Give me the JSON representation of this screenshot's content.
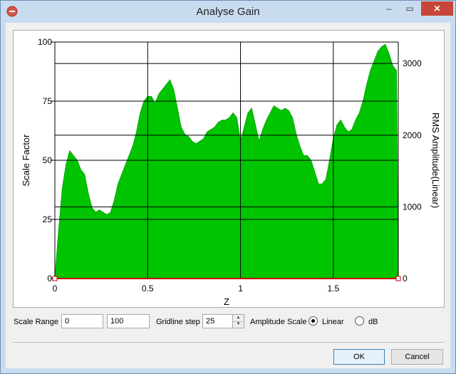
{
  "window": {
    "title": "Analyse Gain",
    "close_glyph": "✕",
    "min_glyph": "‒",
    "max_glyph": "▭"
  },
  "controls": {
    "scale_range_label": "Scale Range",
    "scale_min": "0",
    "scale_max": "100",
    "gridline_label": "Gridline step",
    "gridline_value": "25",
    "amplitude_label": "Amplitude Scale",
    "linear_label": "Linear",
    "db_label": "dB",
    "selected_scale": "linear"
  },
  "buttons": {
    "ok": "OK",
    "cancel": "Cancel"
  },
  "colors": {
    "fill": "#00c400",
    "fill_edge": "#00a800",
    "grid": "#000000",
    "baseline": "#cc0000",
    "close": "#c7463a"
  },
  "icons": {
    "app": "app-icon",
    "spin_up": "spin-up-icon",
    "spin_down": "spin-down-icon"
  },
  "chart_data": {
    "type": "area",
    "xlabel": "Z",
    "ylabel_left": "Scale Factor",
    "ylabel_right": "RMS Amplitude(Linear)",
    "xlim": [
      0,
      1.85
    ],
    "ylim_left": [
      0,
      100
    ],
    "ylim_right": [
      0,
      3300
    ],
    "x_ticks": [
      "0",
      "0.5",
      "1",
      "1.5"
    ],
    "y_ticks_left": [
      "0",
      "25",
      "50",
      "75",
      "100"
    ],
    "y_ticks_right": [
      "0",
      "1000",
      "2000",
      "3000"
    ],
    "grid": true,
    "series": [
      {
        "x": [
          0,
          0.02,
          0.04,
          0.06,
          0.08,
          0.1,
          0.12,
          0.14,
          0.16,
          0.18,
          0.2,
          0.22,
          0.24,
          0.26,
          0.28,
          0.3,
          0.32,
          0.34,
          0.36,
          0.38,
          0.4,
          0.42,
          0.44,
          0.46,
          0.48,
          0.5,
          0.52,
          0.54,
          0.56,
          0.58,
          0.6,
          0.62,
          0.64,
          0.66,
          0.68,
          0.7,
          0.72,
          0.74,
          0.76,
          0.78,
          0.8,
          0.82,
          0.84,
          0.86,
          0.88,
          0.9,
          0.92,
          0.94,
          0.96,
          0.98,
          1.0,
          1.02,
          1.04,
          1.06,
          1.08,
          1.1,
          1.12,
          1.14,
          1.16,
          1.18,
          1.2,
          1.22,
          1.24,
          1.26,
          1.28,
          1.3,
          1.32,
          1.34,
          1.36,
          1.38,
          1.4,
          1.42,
          1.44,
          1.46,
          1.48,
          1.5,
          1.52,
          1.54,
          1.56,
          1.58,
          1.6,
          1.62,
          1.64,
          1.66,
          1.68,
          1.7,
          1.72,
          1.74,
          1.76,
          1.78,
          1.8,
          1.82,
          1.84,
          1.85
        ],
        "values": [
          0,
          20,
          38,
          48,
          54,
          52,
          50,
          46,
          44,
          36,
          30,
          28,
          29,
          28,
          27,
          28,
          33,
          40,
          44,
          48,
          52,
          56,
          62,
          70,
          75,
          77,
          77,
          74,
          78,
          80,
          82,
          84,
          80,
          72,
          64,
          61,
          60,
          58,
          57,
          58,
          59,
          62,
          63,
          64,
          66,
          67,
          67,
          68,
          70,
          68,
          58,
          64,
          70,
          72,
          65,
          58,
          63,
          67,
          70,
          73,
          72,
          71,
          72,
          71,
          68,
          61,
          56,
          52,
          52,
          50,
          45,
          40,
          40,
          42,
          50,
          59,
          65,
          67,
          64,
          62,
          63,
          67,
          70,
          75,
          82,
          88,
          92,
          96,
          98,
          99,
          95,
          90,
          88,
          0
        ]
      }
    ]
  }
}
